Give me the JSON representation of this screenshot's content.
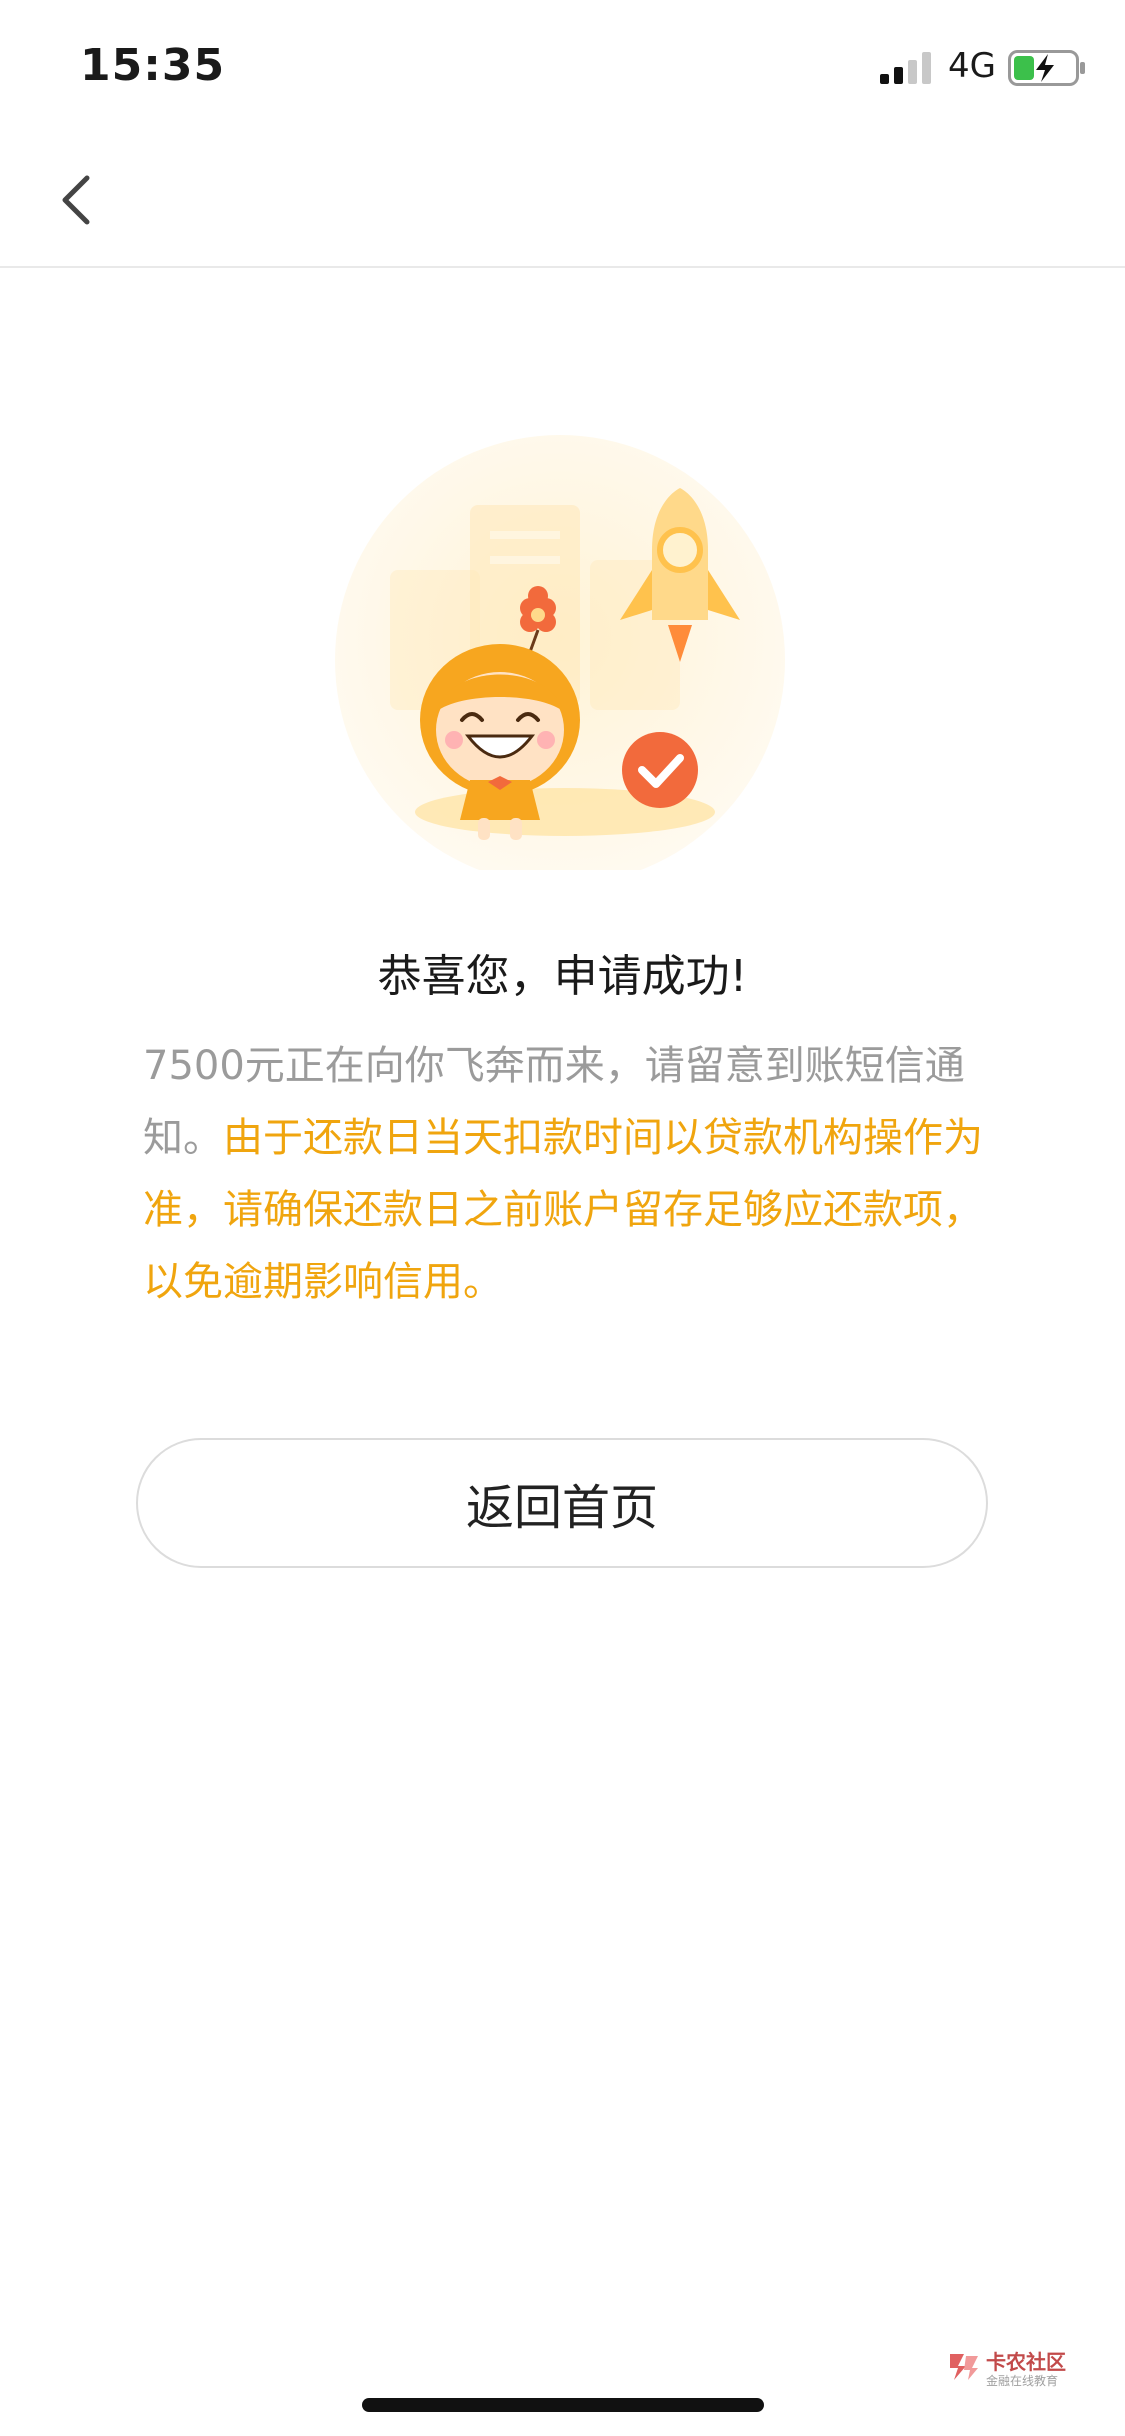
{
  "status_bar": {
    "time": "15:35",
    "network": "4G",
    "icons": [
      "signal-icon",
      "battery-charging-icon"
    ]
  },
  "nav": {
    "back_icon": "chevron-left-icon"
  },
  "illustration": {
    "icons": [
      "cartoon-character",
      "rocket-icon",
      "check-circle-icon"
    ],
    "colors": {
      "accent": "#f59a23",
      "check": "#f26a3c"
    }
  },
  "result": {
    "title": "恭喜您，申请成功!",
    "message_normal": "7500元正在向你飞奔而来，请留意到账短信通知。",
    "message_warning": "由于还款日当天扣款时间以贷款机构操作为准，请确保还款日之前账户留存足够应还款项，以免逾期影响信用。",
    "colors": {
      "normal": "#9b9b9b",
      "warning": "#f0a50e"
    }
  },
  "actions": {
    "home_button": "返回首页"
  },
  "watermark": {
    "title": "卡农社区",
    "subtitle": "金融在线教育"
  }
}
